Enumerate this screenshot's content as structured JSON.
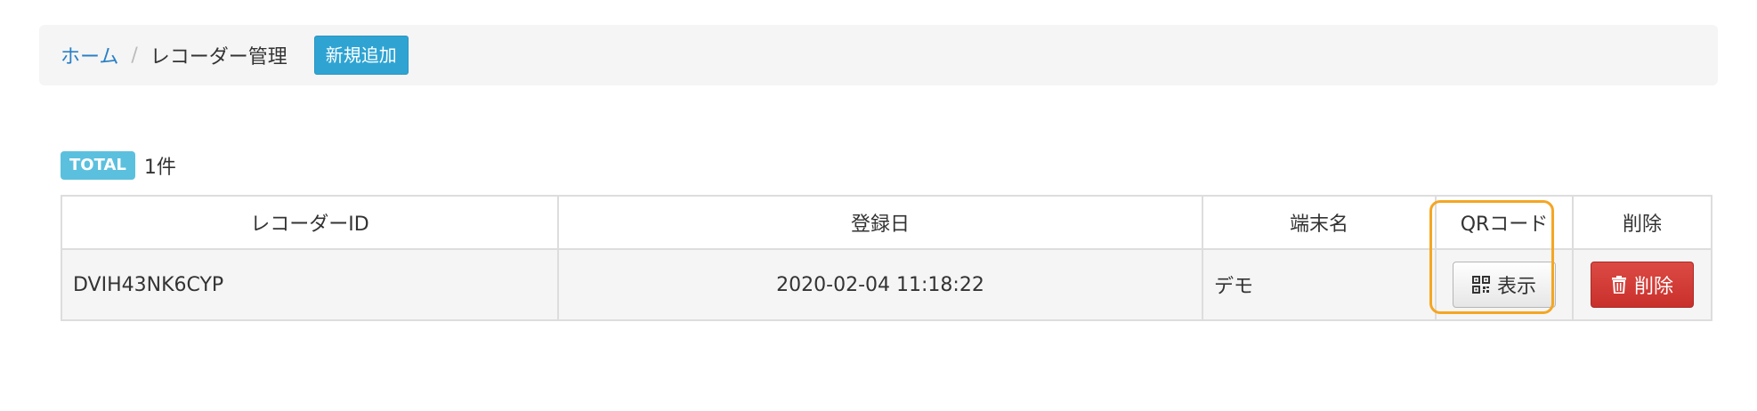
{
  "breadcrumb": {
    "home_label": "ホーム",
    "separator": "/",
    "current_label": "レコーダー管理",
    "new_button_label": "新規追加"
  },
  "summary": {
    "total_badge": "TOTAL",
    "total_count": "1件"
  },
  "table": {
    "columns": [
      "レコーダーID",
      "登録日",
      "端末名",
      "QRコード",
      "削除"
    ],
    "rows": [
      {
        "recorder_id": "DVIH43NK6CYP",
        "registered_at": "2020-02-04 11:18:22",
        "device_name": "デモ",
        "qr_button_label": "表示",
        "delete_button_label": "削除"
      }
    ]
  },
  "colors": {
    "accent": "#2fa4d3",
    "badge": "#5bc0de",
    "danger": "#c9302c",
    "highlight": "#f5a623",
    "link": "#2a80c6"
  },
  "icons": {
    "qr_button": "qrcode-icon",
    "delete_button": "trash-icon"
  }
}
